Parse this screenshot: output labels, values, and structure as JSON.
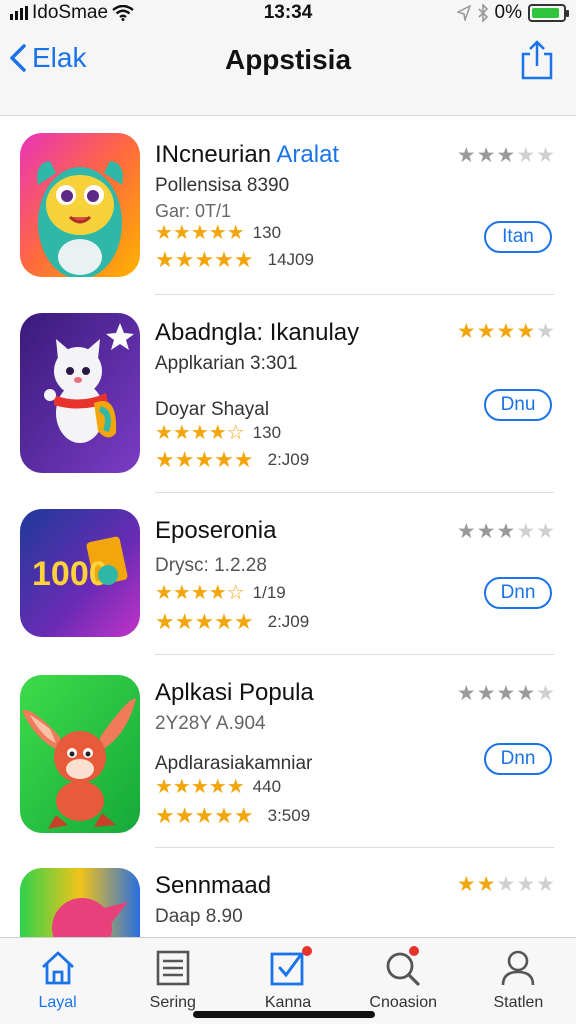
{
  "status_bar": {
    "carrier": "IdoSmae",
    "time": "13:34",
    "battery_percent": "0%",
    "battery_level": 0.9
  },
  "nav": {
    "back_label": "Elak",
    "title": "Appstisia"
  },
  "apps": [
    {
      "title": "INcneurian Aralat",
      "title_accent": "Aralat",
      "subtitle": "Pollensisa 8390",
      "meta": "Gar: 0T/1",
      "stars_count": "130",
      "reviews": "14J09",
      "rating": 3,
      "rating_color": "gray",
      "button": "Itan"
    },
    {
      "title": "Abadngla: Ikanulay",
      "subtitle": "Applkarian 3:301",
      "meta": "Doyar Shayal",
      "stars_count": "130",
      "reviews": "2:J09",
      "rating": 4,
      "rating_color": "gold",
      "button": "Dnu"
    },
    {
      "title": "Eposeronia",
      "subtitle": "Drysc: 1.2.28",
      "meta": "",
      "stars_count": "1/19",
      "reviews": "2:J09",
      "rating": 3,
      "rating_color": "gray",
      "button": "Dnn"
    },
    {
      "title": "Aplkasi Popula",
      "subtitle": "2Y28Y A.904",
      "meta": "Apdlarasiakamniar",
      "stars_count": "440",
      "reviews": "3:509",
      "rating": 4,
      "rating_color": "gray",
      "button": "Dnn"
    },
    {
      "title": "Sennmaad",
      "subtitle": "Daap 8.90",
      "meta": "",
      "stars_count": "",
      "reviews": "",
      "rating": 2,
      "rating_color": "gold",
      "button": ""
    }
  ],
  "icons": {
    "app1": "yellow-monster-icon",
    "app2": "white-cat-icon",
    "app3": "logo-text-icon",
    "app4": "red-bunny-icon",
    "app5": "colorful-bird-icon",
    "app3_text": "1000"
  },
  "tabs": [
    {
      "label": "Layal",
      "icon": "home-icon",
      "active": true
    },
    {
      "label": "Sering",
      "icon": "list-icon",
      "active": false
    },
    {
      "label": "Kanna",
      "icon": "check-square-icon",
      "active": false
    },
    {
      "label": "Cnoasion",
      "icon": "search-icon",
      "active": false
    },
    {
      "label": "Statlen",
      "icon": "person-icon",
      "active": false
    }
  ],
  "colors": {
    "accent": "#1a73e8",
    "star": "#f2a60c",
    "badge": "#e8322c"
  }
}
